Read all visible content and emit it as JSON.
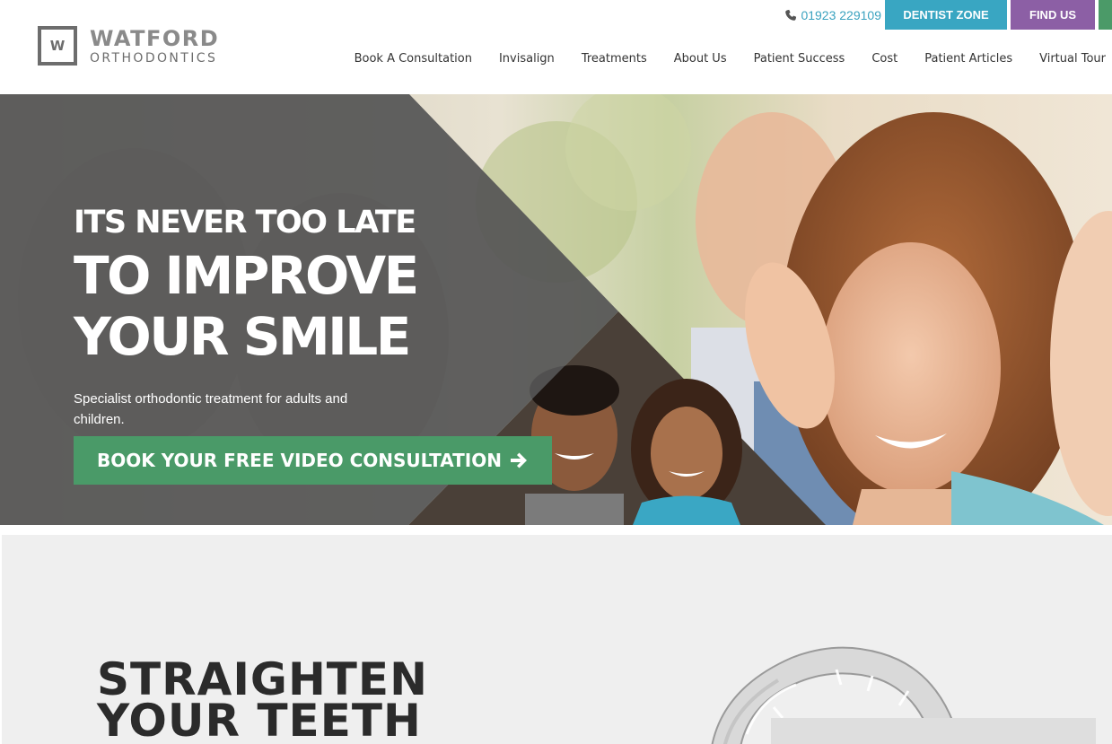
{
  "header": {
    "logo": {
      "letter": "W",
      "title": "WATFORD",
      "subtitle": "ORTHODONTICS"
    },
    "phone": "01923 229109",
    "buttons": {
      "dentist_zone": "DENTIST ZONE",
      "find_us": "FIND US"
    },
    "nav": [
      "Book A Consultation",
      "Invisalign",
      "Treatments",
      "About Us",
      "Patient Success",
      "Cost",
      "Patient Articles",
      "Virtual Tour"
    ],
    "colors": {
      "dentist_zone": "#39a6c2",
      "find_us": "#8c5fa5",
      "accent_green": "#4b9a68",
      "phone": "#3aa2bf"
    }
  },
  "hero": {
    "kicker": "ITS NEVER TOO LATE",
    "title_line1": "TO IMPROVE",
    "title_line2": "YOUR SMILE",
    "description": "Specialist orthodontic treatment for adults and children.",
    "cta_label": "BOOK YOUR FREE VIDEO CONSULTATION",
    "cta_icon": "arrow-right-icon"
  },
  "section2": {
    "heading_line1": "STRAIGHTEN",
    "heading_line2": "YOUR TEETH"
  }
}
